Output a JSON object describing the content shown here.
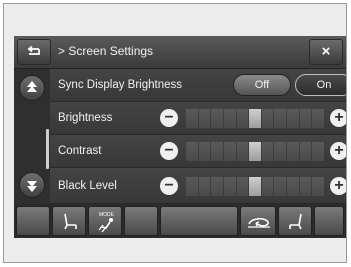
{
  "header": {
    "title": "> Screen Settings",
    "back_icon": "back-arrow-icon",
    "close_label": "×"
  },
  "scroll": {
    "up_icon": "scroll-up-icon",
    "down_icon": "scroll-down-icon"
  },
  "rows": [
    {
      "label": "Sync Display Brightness",
      "options": [
        "Off",
        "On"
      ],
      "selected": "Off"
    },
    {
      "label": "Brightness",
      "level": 0.5,
      "minus": "−",
      "plus": "+"
    },
    {
      "label": "Contrast",
      "level": 0.5,
      "minus": "−",
      "plus": "+"
    },
    {
      "label": "Black Level",
      "level": 0.5,
      "minus": "−",
      "plus": "+"
    }
  ],
  "bottom_bar": {
    "icons": [
      "blank",
      "driver-seat-icon",
      "climate-mode-icon",
      "blank",
      "blank",
      "recirculation-icon",
      "passenger-seat-icon",
      "blank"
    ],
    "mode_caption": "MODE"
  }
}
